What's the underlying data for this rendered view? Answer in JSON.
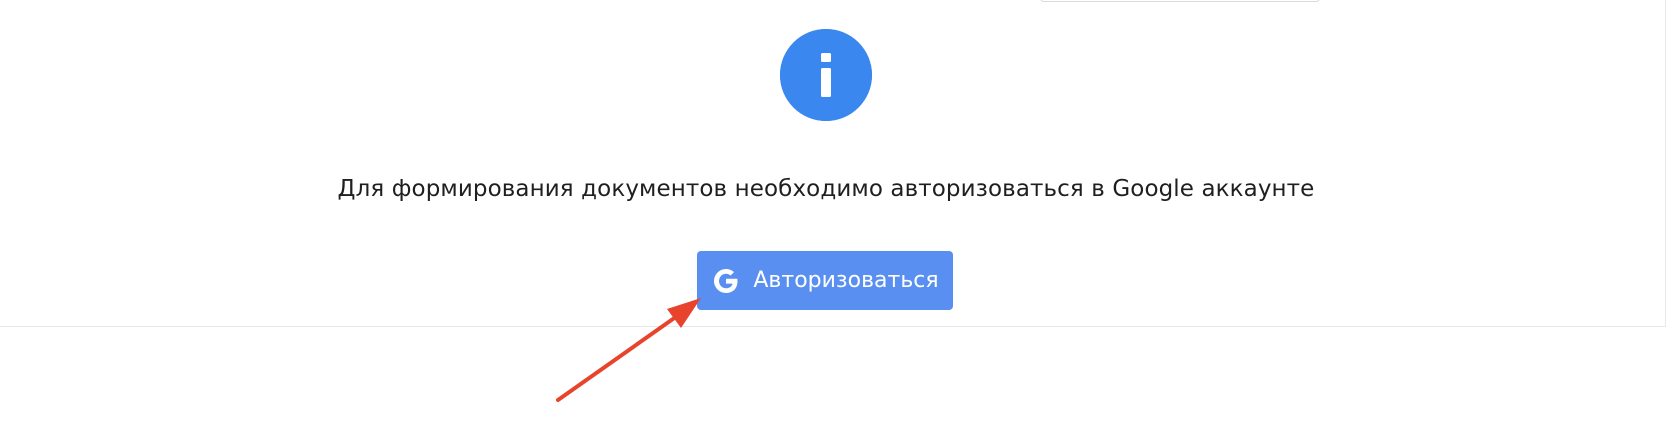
{
  "message": "Для формирования документов необходимо авторизоваться в Google аккаунте",
  "auth_button": {
    "label": "Авторизоваться",
    "icon": "google-icon"
  },
  "info_icon": "info-icon",
  "colors": {
    "accent": "#3a87ef",
    "button": "#5a8ff2",
    "annotation_arrow": "#e8432d"
  }
}
